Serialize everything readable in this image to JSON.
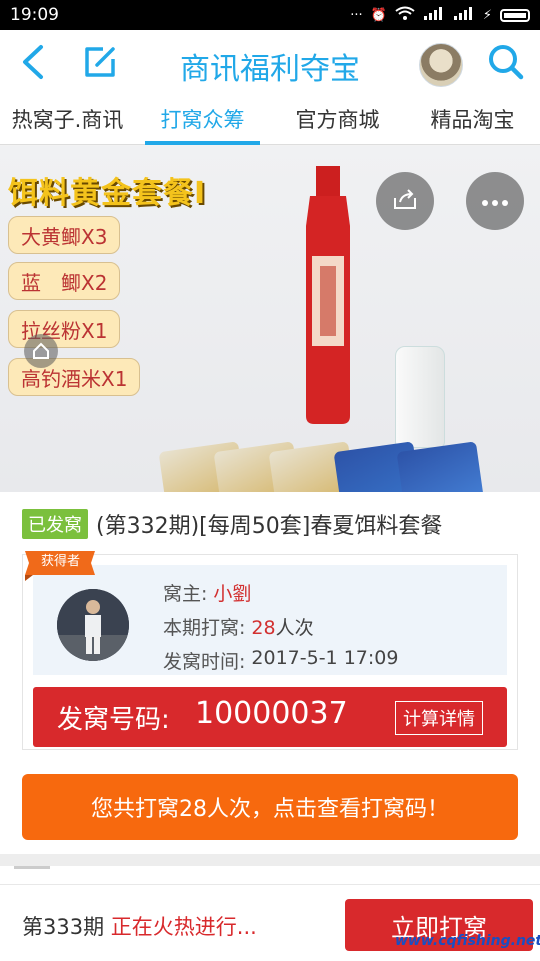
{
  "status_bar": {
    "time": "19:09"
  },
  "header": {
    "title": "商讯福利夺宝",
    "back_icon": "back-arrow-icon",
    "edit_icon": "edit-icon",
    "search_icon": "search-icon"
  },
  "tabs": [
    {
      "label": "热窝子.商讯",
      "active": false
    },
    {
      "label": "打窝众筹",
      "active": true
    },
    {
      "label": "官方商城",
      "active": false
    },
    {
      "label": "精品淘宝",
      "active": false
    }
  ],
  "banner": {
    "title": "饵料黄金套餐Ⅰ",
    "items": [
      "大黄鲫X3",
      "蓝　鲫X2",
      "拉丝粉X1",
      "高钓酒米X1"
    ]
  },
  "item": {
    "status_tag": "已发窝",
    "title": "(第332期)[每周50套]春夏饵料套餐"
  },
  "winner": {
    "ribbon": "获得者",
    "owner_label": "窝主:",
    "owner_value": "小劉",
    "count_label": "本期打窝:",
    "count_value": "28",
    "count_unit": "人次",
    "time_label": "发窝时间:",
    "time_value": "2017-5-1 17:09"
  },
  "code": {
    "label": "发窝号码:",
    "value": "10000037",
    "detail_button": "计算详情"
  },
  "cta": {
    "label": "您共打窝28人次，点击查看打窝码！"
  },
  "bottom": {
    "issue": "第333期",
    "status": "正在火热进行...",
    "button": "立即打窝",
    "watermark": "www.cqfishing.net"
  },
  "colors": {
    "accent": "#21a8e8",
    "red": "#d8292c",
    "orange": "#f7690e",
    "green_tag": "#7bc03d"
  }
}
